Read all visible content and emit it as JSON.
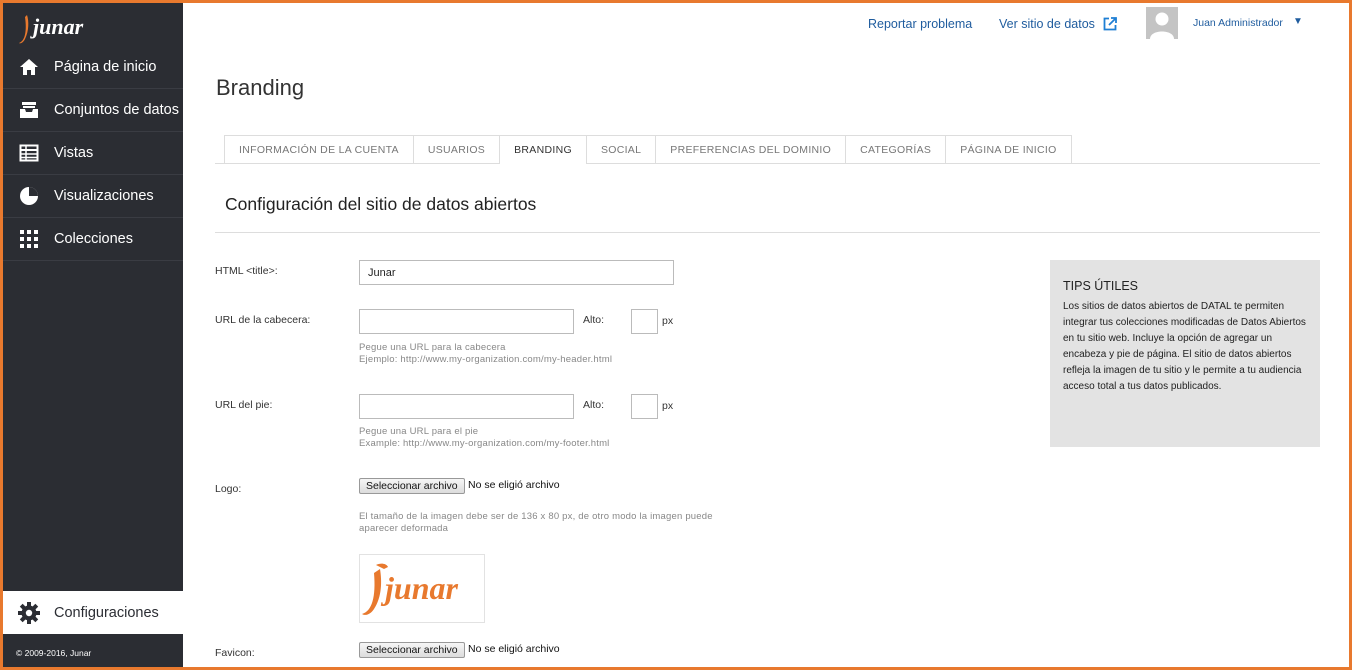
{
  "brand": {
    "name": "junar",
    "accent": "#e8792e",
    "sidebar_bg": "#2b2d33",
    "link_color": "#1f5c9e"
  },
  "sidebar": {
    "items": [
      {
        "label": "Página de inicio",
        "icon": "home-icon"
      },
      {
        "label": "Conjuntos de datos",
        "icon": "inbox-icon"
      },
      {
        "label": "Vistas",
        "icon": "table-icon"
      },
      {
        "label": "Visualizaciones",
        "icon": "pie-chart-icon"
      },
      {
        "label": "Colecciones",
        "icon": "grid-icon"
      }
    ],
    "settings": {
      "label": "Configuraciones",
      "icon": "gear-icon"
    },
    "copyright": "© 2009-2016, Junar"
  },
  "header": {
    "report_link": "Reportar problema",
    "site_link": "Ver sitio de datos",
    "user_name": "Juan Administrador",
    "caret": "▼"
  },
  "page": {
    "title": "Branding"
  },
  "tabs": [
    {
      "label": "INFORMACIÓN DE LA CUENTA"
    },
    {
      "label": "USUARIOS"
    },
    {
      "label": "BRANDING"
    },
    {
      "label": "SOCIAL"
    },
    {
      "label": "PREFERENCIAS DEL DOMINIO"
    },
    {
      "label": "CATEGORÍAS"
    },
    {
      "label": "PÁGINA DE INICIO"
    }
  ],
  "section": {
    "title": "Configuración del sitio de datos abiertos"
  },
  "form": {
    "html_title": {
      "label": "HTML <title>:",
      "value": "Junar"
    },
    "header_url": {
      "label": "URL de la cabecera:",
      "value": "",
      "height_label": "Alto:",
      "height_value": "",
      "unit": "px",
      "help1": "Pegue una URL para la cabecera",
      "help2": "Ejemplo: http://www.my-organization.com/my-header.html"
    },
    "footer_url": {
      "label": "URL del pie:",
      "value": "",
      "height_label": "Alto:",
      "height_value": "",
      "unit": "px",
      "help1": "Pegue una URL para el pie",
      "help2": "Example: http://www.my-organization.com/my-footer.html"
    },
    "logo": {
      "label": "Logo:",
      "button": "Seleccionar archivo",
      "file_status": "No se eligió archivo",
      "help1": "El tamaño de la imagen debe ser de 136 x 80 px, de otro modo la imagen puede",
      "help2": "aparecer deformada",
      "preview_text": "junar"
    },
    "favicon": {
      "label": "Favicon:",
      "button": "Seleccionar archivo",
      "file_status": "No se eligió archivo"
    }
  },
  "tips": {
    "title": "TIPS ÚTILES",
    "body": "Los sitios de datos abiertos de DATAL te permiten integrar tus colecciones modificadas de Datos Abiertos en tu sitio web. Incluye la opción de agregar un encabeza y pie de página. El sitio de datos abiertos refleja la imagen de tu sitio y le permite a tu audiencia acceso total a tus datos publicados."
  }
}
